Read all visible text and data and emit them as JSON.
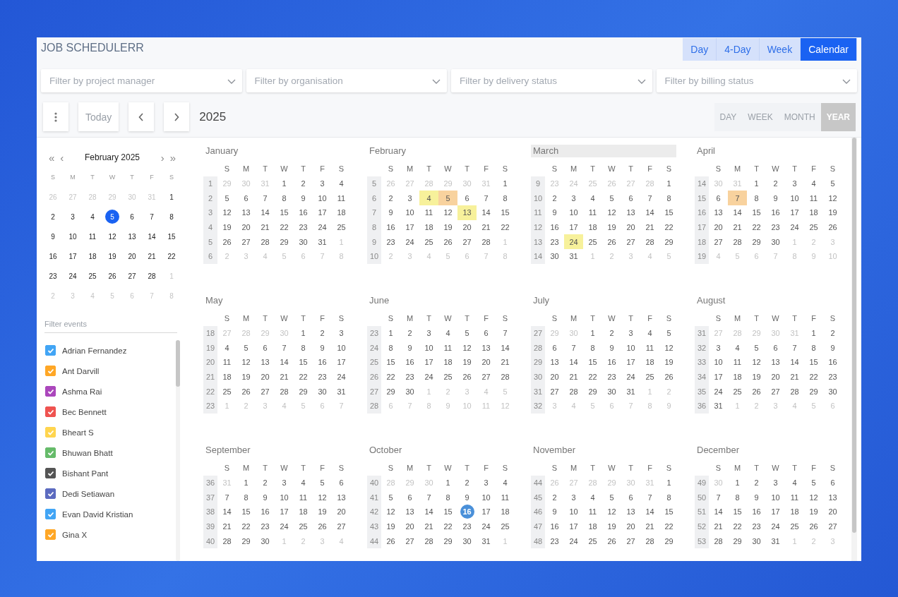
{
  "app_title": "JOB SCHEDULERR",
  "view_tabs": [
    {
      "label": "Day",
      "selected": false
    },
    {
      "label": "4-Day",
      "selected": false
    },
    {
      "label": "Week",
      "selected": false
    },
    {
      "label": "Calendar",
      "selected": true
    }
  ],
  "filters": [
    {
      "placeholder": "Filter by project manager"
    },
    {
      "placeholder": "Filter by organisation"
    },
    {
      "placeholder": "Filter by delivery status"
    },
    {
      "placeholder": "Filter by billing status"
    }
  ],
  "toolbar": {
    "today": "Today",
    "period": "2025"
  },
  "range_tabs": [
    {
      "label": "DAY",
      "selected": false
    },
    {
      "label": "WEEK",
      "selected": false
    },
    {
      "label": "MONTH",
      "selected": false
    },
    {
      "label": "YEAR",
      "selected": true
    }
  ],
  "mini_calendar": {
    "title": "February 2025",
    "first": "«",
    "prev": "‹",
    "next": "›",
    "last": "»",
    "weekdays": [
      "S",
      "M",
      "T",
      "W",
      "T",
      "F",
      "S"
    ],
    "weeks": [
      {
        "days": [
          "26",
          "27",
          "28",
          "29",
          "30",
          "31",
          "1"
        ],
        "muted": [
          true,
          true,
          true,
          true,
          true,
          true,
          false
        ]
      },
      {
        "days": [
          "2",
          "3",
          "4",
          "5",
          "6",
          "7",
          "8"
        ],
        "muted": [
          false,
          false,
          false,
          false,
          false,
          false,
          false
        ],
        "selected": [
          false,
          false,
          false,
          true,
          false,
          false,
          false
        ]
      },
      {
        "days": [
          "9",
          "10",
          "11",
          "12",
          "13",
          "14",
          "15"
        ],
        "muted": [
          false,
          false,
          false,
          false,
          false,
          false,
          false
        ]
      },
      {
        "days": [
          "16",
          "17",
          "18",
          "19",
          "20",
          "21",
          "22"
        ],
        "muted": [
          false,
          false,
          false,
          false,
          false,
          false,
          false
        ]
      },
      {
        "days": [
          "23",
          "24",
          "25",
          "26",
          "27",
          "28",
          "1"
        ],
        "muted": [
          false,
          false,
          false,
          false,
          false,
          false,
          true
        ]
      },
      {
        "days": [
          "2",
          "3",
          "4",
          "5",
          "6",
          "7",
          "8"
        ],
        "muted": [
          true,
          true,
          true,
          true,
          true,
          true,
          true
        ]
      }
    ]
  },
  "event_filter": {
    "placeholder": "Filter events",
    "people": [
      {
        "name": "Adrian Fernandez",
        "color": "#42a5f5",
        "checked": true
      },
      {
        "name": "Ant Darvill",
        "color": "#ffa726",
        "checked": true
      },
      {
        "name": "Ashma Rai",
        "color": "#ab47bc",
        "checked": true
      },
      {
        "name": "Bec Bennett",
        "color": "#ef5350",
        "checked": true
      },
      {
        "name": "Bheart S",
        "color": "#ffd54f",
        "checked": true
      },
      {
        "name": "Bhuwan Bhatt",
        "color": "#66bb6a",
        "checked": true
      },
      {
        "name": "Bishant Pant",
        "color": "#555555",
        "checked": true
      },
      {
        "name": "Dedi Setiawan",
        "color": "#5c6bc0",
        "checked": true
      },
      {
        "name": "Evan David Kristian",
        "color": "#42a5f5",
        "checked": true
      },
      {
        "name": "Gina X",
        "color": "#ffa726",
        "checked": true
      }
    ]
  },
  "year": {
    "months": [
      {
        "name": "January",
        "selected": false,
        "weekdays": [
          "S",
          "M",
          "T",
          "W",
          "T",
          "F",
          "S"
        ],
        "weeks": [
          {
            "no": "1",
            "days": [
              "29",
              "30",
              "31",
              "1",
              "2",
              "3",
              "4"
            ],
            "muted": [
              true,
              true,
              true,
              false,
              false,
              false,
              false
            ]
          },
          {
            "no": "2",
            "days": [
              "5",
              "6",
              "7",
              "8",
              "9",
              "10",
              "11"
            ],
            "muted": [
              false,
              false,
              false,
              false,
              false,
              false,
              false
            ]
          },
          {
            "no": "3",
            "days": [
              "12",
              "13",
              "14",
              "15",
              "16",
              "17",
              "18"
            ],
            "muted": [
              false,
              false,
              false,
              false,
              false,
              false,
              false
            ]
          },
          {
            "no": "4",
            "days": [
              "19",
              "20",
              "21",
              "22",
              "23",
              "24",
              "25"
            ],
            "muted": [
              false,
              false,
              false,
              false,
              false,
              false,
              false
            ]
          },
          {
            "no": "5",
            "days": [
              "26",
              "27",
              "28",
              "29",
              "30",
              "31",
              "1"
            ],
            "muted": [
              false,
              false,
              false,
              false,
              false,
              false,
              true
            ]
          },
          {
            "no": "6",
            "days": [
              "2",
              "3",
              "4",
              "5",
              "6",
              "7",
              "8"
            ],
            "muted": [
              true,
              true,
              true,
              true,
              true,
              true,
              true
            ]
          }
        ]
      },
      {
        "name": "February",
        "selected": false,
        "weekdays": [
          "S",
          "M",
          "T",
          "W",
          "T",
          "F",
          "S"
        ],
        "weeks": [
          {
            "no": "5",
            "days": [
              "26",
              "27",
              "28",
              "29",
              "30",
              "31",
              "1"
            ],
            "muted": [
              true,
              true,
              true,
              true,
              true,
              true,
              false
            ]
          },
          {
            "no": "6",
            "days": [
              "2",
              "3",
              "4",
              "5",
              "6",
              "7",
              "8"
            ],
            "muted": [
              false,
              false,
              false,
              false,
              false,
              false,
              false
            ],
            "event": [
              false,
              false,
              true,
              false,
              false,
              false,
              false
            ],
            "busy": [
              false,
              false,
              false,
              true,
              false,
              false,
              false
            ]
          },
          {
            "no": "7",
            "days": [
              "9",
              "10",
              "11",
              "12",
              "13",
              "14",
              "15"
            ],
            "muted": [
              false,
              false,
              false,
              false,
              false,
              false,
              false
            ],
            "event": [
              false,
              false,
              false,
              false,
              true,
              false,
              false
            ]
          },
          {
            "no": "8",
            "days": [
              "16",
              "17",
              "18",
              "19",
              "20",
              "21",
              "22"
            ],
            "muted": [
              false,
              false,
              false,
              false,
              false,
              false,
              false
            ]
          },
          {
            "no": "9",
            "days": [
              "23",
              "24",
              "25",
              "26",
              "27",
              "28",
              "1"
            ],
            "muted": [
              false,
              false,
              false,
              false,
              false,
              false,
              true
            ]
          },
          {
            "no": "10",
            "days": [
              "2",
              "3",
              "4",
              "5",
              "6",
              "7",
              "8"
            ],
            "muted": [
              true,
              true,
              true,
              true,
              true,
              true,
              true
            ]
          }
        ]
      },
      {
        "name": "March",
        "selected": true,
        "weekdays": [
          "S",
          "M",
          "T",
          "W",
          "T",
          "F",
          "S"
        ],
        "weeks": [
          {
            "no": "9",
            "days": [
              "23",
              "24",
              "25",
              "26",
              "27",
              "28",
              "1"
            ],
            "muted": [
              true,
              true,
              true,
              true,
              true,
              true,
              false
            ]
          },
          {
            "no": "10",
            "days": [
              "2",
              "3",
              "4",
              "5",
              "6",
              "7",
              "8"
            ],
            "muted": [
              false,
              false,
              false,
              false,
              false,
              false,
              false
            ]
          },
          {
            "no": "11",
            "days": [
              "9",
              "10",
              "11",
              "12",
              "13",
              "14",
              "15"
            ],
            "muted": [
              false,
              false,
              false,
              false,
              false,
              false,
              false
            ]
          },
          {
            "no": "12",
            "days": [
              "16",
              "17",
              "18",
              "19",
              "20",
              "21",
              "22"
            ],
            "muted": [
              false,
              false,
              false,
              false,
              false,
              false,
              false
            ]
          },
          {
            "no": "13",
            "days": [
              "23",
              "24",
              "25",
              "26",
              "27",
              "28",
              "29"
            ],
            "muted": [
              false,
              false,
              false,
              false,
              false,
              false,
              false
            ],
            "event": [
              false,
              true,
              false,
              false,
              false,
              false,
              false
            ]
          },
          {
            "no": "14",
            "days": [
              "30",
              "31",
              "1",
              "2",
              "3",
              "4",
              "5"
            ],
            "muted": [
              false,
              false,
              true,
              true,
              true,
              true,
              true
            ]
          }
        ]
      },
      {
        "name": "April",
        "selected": false,
        "weekdays": [
          "S",
          "M",
          "T",
          "W",
          "T",
          "F",
          "S"
        ],
        "weeks": [
          {
            "no": "14",
            "days": [
              "30",
              "31",
              "1",
              "2",
              "3",
              "4",
              "5"
            ],
            "muted": [
              true,
              true,
              false,
              false,
              false,
              false,
              false
            ]
          },
          {
            "no": "15",
            "days": [
              "6",
              "7",
              "8",
              "9",
              "10",
              "11",
              "12"
            ],
            "muted": [
              false,
              false,
              false,
              false,
              false,
              false,
              false
            ],
            "busy": [
              false,
              true,
              false,
              false,
              false,
              false,
              false
            ]
          },
          {
            "no": "16",
            "days": [
              "13",
              "14",
              "15",
              "16",
              "17",
              "18",
              "19"
            ],
            "muted": [
              false,
              false,
              false,
              false,
              false,
              false,
              false
            ]
          },
          {
            "no": "17",
            "days": [
              "20",
              "21",
              "22",
              "23",
              "24",
              "25",
              "26"
            ],
            "muted": [
              false,
              false,
              false,
              false,
              false,
              false,
              false
            ]
          },
          {
            "no": "18",
            "days": [
              "27",
              "28",
              "29",
              "30",
              "1",
              "2",
              "3"
            ],
            "muted": [
              false,
              false,
              false,
              false,
              true,
              true,
              true
            ]
          },
          {
            "no": "19",
            "days": [
              "4",
              "5",
              "6",
              "7",
              "8",
              "9",
              "10"
            ],
            "muted": [
              true,
              true,
              true,
              true,
              true,
              true,
              true
            ]
          }
        ]
      },
      {
        "name": "May",
        "selected": false,
        "weekdays": [
          "S",
          "M",
          "T",
          "W",
          "T",
          "F",
          "S"
        ],
        "weeks": [
          {
            "no": "18",
            "days": [
              "27",
              "28",
              "29",
              "30",
              "1",
              "2",
              "3"
            ],
            "muted": [
              true,
              true,
              true,
              true,
              false,
              false,
              false
            ]
          },
          {
            "no": "19",
            "days": [
              "4",
              "5",
              "6",
              "7",
              "8",
              "9",
              "10"
            ],
            "muted": [
              false,
              false,
              false,
              false,
              false,
              false,
              false
            ]
          },
          {
            "no": "20",
            "days": [
              "11",
              "12",
              "13",
              "14",
              "15",
              "16",
              "17"
            ],
            "muted": [
              false,
              false,
              false,
              false,
              false,
              false,
              false
            ]
          },
          {
            "no": "21",
            "days": [
              "18",
              "19",
              "20",
              "21",
              "22",
              "23",
              "24"
            ],
            "muted": [
              false,
              false,
              false,
              false,
              false,
              false,
              false
            ]
          },
          {
            "no": "22",
            "days": [
              "25",
              "26",
              "27",
              "28",
              "29",
              "30",
              "31"
            ],
            "muted": [
              false,
              false,
              false,
              false,
              false,
              false,
              false
            ]
          },
          {
            "no": "23",
            "days": [
              "1",
              "2",
              "3",
              "4",
              "5",
              "6",
              "7"
            ],
            "muted": [
              true,
              true,
              true,
              true,
              true,
              true,
              true
            ]
          }
        ]
      },
      {
        "name": "June",
        "selected": false,
        "weekdays": [
          "S",
          "M",
          "T",
          "W",
          "T",
          "F",
          "S"
        ],
        "weeks": [
          {
            "no": "23",
            "days": [
              "1",
              "2",
              "3",
              "4",
              "5",
              "6",
              "7"
            ],
            "muted": [
              false,
              false,
              false,
              false,
              false,
              false,
              false
            ]
          },
          {
            "no": "24",
            "days": [
              "8",
              "9",
              "10",
              "11",
              "12",
              "13",
              "14"
            ],
            "muted": [
              false,
              false,
              false,
              false,
              false,
              false,
              false
            ]
          },
          {
            "no": "25",
            "days": [
              "15",
              "16",
              "17",
              "18",
              "19",
              "20",
              "21"
            ],
            "muted": [
              false,
              false,
              false,
              false,
              false,
              false,
              false
            ]
          },
          {
            "no": "26",
            "days": [
              "22",
              "23",
              "24",
              "25",
              "26",
              "27",
              "28"
            ],
            "muted": [
              false,
              false,
              false,
              false,
              false,
              false,
              false
            ]
          },
          {
            "no": "27",
            "days": [
              "29",
              "30",
              "1",
              "2",
              "3",
              "4",
              "5"
            ],
            "muted": [
              false,
              false,
              true,
              true,
              true,
              true,
              true
            ]
          },
          {
            "no": "28",
            "days": [
              "6",
              "7",
              "8",
              "9",
              "10",
              "11",
              "12"
            ],
            "muted": [
              true,
              true,
              true,
              true,
              true,
              true,
              true
            ]
          }
        ]
      },
      {
        "name": "July",
        "selected": false,
        "weekdays": [
          "S",
          "M",
          "T",
          "W",
          "T",
          "F",
          "S"
        ],
        "weeks": [
          {
            "no": "27",
            "days": [
              "29",
              "30",
              "1",
              "2",
              "3",
              "4",
              "5"
            ],
            "muted": [
              true,
              true,
              false,
              false,
              false,
              false,
              false
            ]
          },
          {
            "no": "28",
            "days": [
              "6",
              "7",
              "8",
              "9",
              "10",
              "11",
              "12"
            ],
            "muted": [
              false,
              false,
              false,
              false,
              false,
              false,
              false
            ]
          },
          {
            "no": "29",
            "days": [
              "13",
              "14",
              "15",
              "16",
              "17",
              "18",
              "19"
            ],
            "muted": [
              false,
              false,
              false,
              false,
              false,
              false,
              false
            ]
          },
          {
            "no": "30",
            "days": [
              "20",
              "21",
              "22",
              "23",
              "24",
              "25",
              "26"
            ],
            "muted": [
              false,
              false,
              false,
              false,
              false,
              false,
              false
            ]
          },
          {
            "no": "31",
            "days": [
              "27",
              "28",
              "29",
              "30",
              "31",
              "1",
              "2"
            ],
            "muted": [
              false,
              false,
              false,
              false,
              false,
              true,
              true
            ]
          },
          {
            "no": "32",
            "days": [
              "3",
              "4",
              "5",
              "6",
              "7",
              "8",
              "9"
            ],
            "muted": [
              true,
              true,
              true,
              true,
              true,
              true,
              true
            ]
          }
        ]
      },
      {
        "name": "August",
        "selected": false,
        "weekdays": [
          "S",
          "M",
          "T",
          "W",
          "T",
          "F",
          "S"
        ],
        "weeks": [
          {
            "no": "31",
            "days": [
              "27",
              "28",
              "29",
              "30",
              "31",
              "1",
              "2"
            ],
            "muted": [
              true,
              true,
              true,
              true,
              true,
              false,
              false
            ]
          },
          {
            "no": "32",
            "days": [
              "3",
              "4",
              "5",
              "6",
              "7",
              "8",
              "9"
            ],
            "muted": [
              false,
              false,
              false,
              false,
              false,
              false,
              false
            ]
          },
          {
            "no": "33",
            "days": [
              "10",
              "11",
              "12",
              "13",
              "14",
              "15",
              "16"
            ],
            "muted": [
              false,
              false,
              false,
              false,
              false,
              false,
              false
            ]
          },
          {
            "no": "34",
            "days": [
              "17",
              "18",
              "19",
              "20",
              "21",
              "22",
              "23"
            ],
            "muted": [
              false,
              false,
              false,
              false,
              false,
              false,
              false
            ]
          },
          {
            "no": "35",
            "days": [
              "24",
              "25",
              "26",
              "27",
              "28",
              "29",
              "30"
            ],
            "muted": [
              false,
              false,
              false,
              false,
              false,
              false,
              false
            ]
          },
          {
            "no": "36",
            "days": [
              "31",
              "1",
              "2",
              "3",
              "4",
              "5",
              "6"
            ],
            "muted": [
              false,
              true,
              true,
              true,
              true,
              true,
              true
            ]
          }
        ]
      },
      {
        "name": "September",
        "selected": false,
        "weekdays": [
          "S",
          "M",
          "T",
          "W",
          "T",
          "F",
          "S"
        ],
        "weeks": [
          {
            "no": "36",
            "days": [
              "31",
              "1",
              "2",
              "3",
              "4",
              "5",
              "6"
            ],
            "muted": [
              true,
              false,
              false,
              false,
              false,
              false,
              false
            ]
          },
          {
            "no": "37",
            "days": [
              "7",
              "8",
              "9",
              "10",
              "11",
              "12",
              "13"
            ],
            "muted": [
              false,
              false,
              false,
              false,
              false,
              false,
              false
            ]
          },
          {
            "no": "38",
            "days": [
              "14",
              "15",
              "16",
              "17",
              "18",
              "19",
              "20"
            ],
            "muted": [
              false,
              false,
              false,
              false,
              false,
              false,
              false
            ]
          },
          {
            "no": "39",
            "days": [
              "21",
              "22",
              "23",
              "24",
              "25",
              "26",
              "27"
            ],
            "muted": [
              false,
              false,
              false,
              false,
              false,
              false,
              false
            ]
          },
          {
            "no": "40",
            "days": [
              "28",
              "29",
              "30",
              "1",
              "2",
              "3",
              "4"
            ],
            "muted": [
              false,
              false,
              false,
              true,
              true,
              true,
              true
            ]
          }
        ]
      },
      {
        "name": "October",
        "selected": false,
        "weekdays": [
          "S",
          "M",
          "T",
          "W",
          "T",
          "F",
          "S"
        ],
        "weeks": [
          {
            "no": "40",
            "days": [
              "28",
              "29",
              "30",
              "1",
              "2",
              "3",
              "4"
            ],
            "muted": [
              true,
              true,
              true,
              false,
              false,
              false,
              false
            ]
          },
          {
            "no": "41",
            "days": [
              "5",
              "6",
              "7",
              "8",
              "9",
              "10",
              "11"
            ],
            "muted": [
              false,
              false,
              false,
              false,
              false,
              false,
              false
            ]
          },
          {
            "no": "42",
            "days": [
              "12",
              "13",
              "14",
              "15",
              "16",
              "17",
              "18"
            ],
            "muted": [
              false,
              false,
              false,
              false,
              false,
              false,
              false
            ],
            "today": [
              false,
              false,
              false,
              false,
              true,
              false,
              false
            ]
          },
          {
            "no": "43",
            "days": [
              "19",
              "20",
              "21",
              "22",
              "23",
              "24",
              "25"
            ],
            "muted": [
              false,
              false,
              false,
              false,
              false,
              false,
              false
            ]
          },
          {
            "no": "44",
            "days": [
              "26",
              "27",
              "28",
              "29",
              "30",
              "31",
              "1"
            ],
            "muted": [
              false,
              false,
              false,
              false,
              false,
              false,
              true
            ]
          }
        ]
      },
      {
        "name": "November",
        "selected": false,
        "weekdays": [
          "S",
          "M",
          "T",
          "W",
          "T",
          "F",
          "S"
        ],
        "weeks": [
          {
            "no": "44",
            "days": [
              "26",
              "27",
              "28",
              "29",
              "30",
              "31",
              "1"
            ],
            "muted": [
              true,
              true,
              true,
              true,
              true,
              true,
              false
            ]
          },
          {
            "no": "45",
            "days": [
              "2",
              "3",
              "4",
              "5",
              "6",
              "7",
              "8"
            ],
            "muted": [
              false,
              false,
              false,
              false,
              false,
              false,
              false
            ]
          },
          {
            "no": "46",
            "days": [
              "9",
              "10",
              "11",
              "12",
              "13",
              "14",
              "15"
            ],
            "muted": [
              false,
              false,
              false,
              false,
              false,
              false,
              false
            ]
          },
          {
            "no": "47",
            "days": [
              "16",
              "17",
              "18",
              "19",
              "20",
              "21",
              "22"
            ],
            "muted": [
              false,
              false,
              false,
              false,
              false,
              false,
              false
            ]
          },
          {
            "no": "48",
            "days": [
              "23",
              "24",
              "25",
              "26",
              "27",
              "28",
              "29"
            ],
            "muted": [
              false,
              false,
              false,
              false,
              false,
              false,
              false
            ]
          }
        ]
      },
      {
        "name": "December",
        "selected": false,
        "weekdays": [
          "S",
          "M",
          "T",
          "W",
          "T",
          "F",
          "S"
        ],
        "weeks": [
          {
            "no": "49",
            "days": [
              "30",
              "1",
              "2",
              "3",
              "4",
              "5",
              "6"
            ],
            "muted": [
              true,
              false,
              false,
              false,
              false,
              false,
              false
            ]
          },
          {
            "no": "50",
            "days": [
              "7",
              "8",
              "9",
              "10",
              "11",
              "12",
              "13"
            ],
            "muted": [
              false,
              false,
              false,
              false,
              false,
              false,
              false
            ]
          },
          {
            "no": "51",
            "days": [
              "14",
              "15",
              "16",
              "17",
              "18",
              "19",
              "20"
            ],
            "muted": [
              false,
              false,
              false,
              false,
              false,
              false,
              false
            ]
          },
          {
            "no": "52",
            "days": [
              "21",
              "22",
              "23",
              "24",
              "25",
              "26",
              "27"
            ],
            "muted": [
              false,
              false,
              false,
              false,
              false,
              false,
              false
            ]
          },
          {
            "no": "53",
            "days": [
              "28",
              "29",
              "30",
              "31",
              "1",
              "2",
              "3"
            ],
            "muted": [
              false,
              false,
              false,
              false,
              true,
              true,
              true
            ]
          }
        ]
      }
    ]
  }
}
